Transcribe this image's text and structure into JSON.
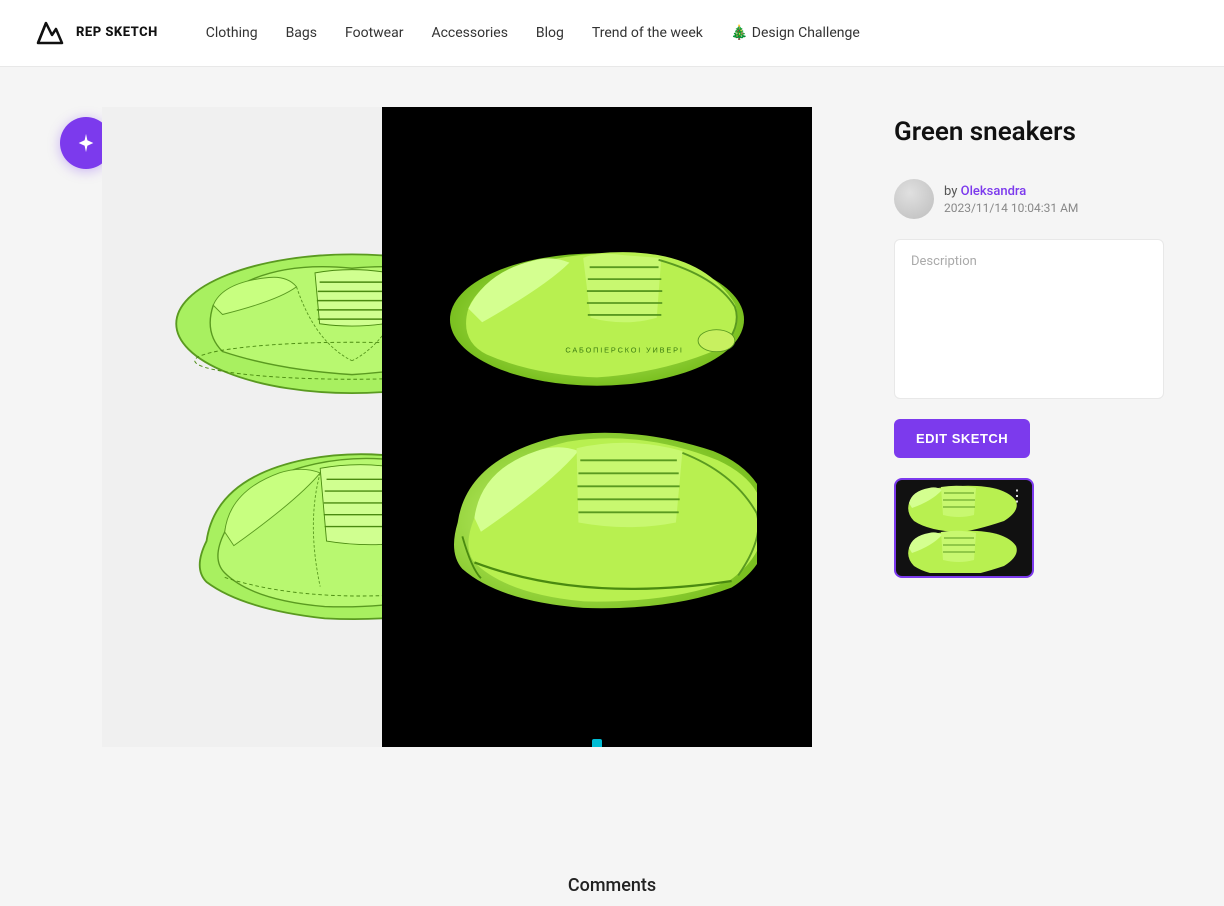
{
  "logo": {
    "name": "REP SKETCH",
    "line1": "REP",
    "line2": "SKETCH"
  },
  "nav": {
    "links": [
      {
        "id": "clothing",
        "label": "Clothing"
      },
      {
        "id": "bags",
        "label": "Bags"
      },
      {
        "id": "footwear",
        "label": "Footwear"
      },
      {
        "id": "accessories",
        "label": "Accessories"
      },
      {
        "id": "blog",
        "label": "Blog"
      },
      {
        "id": "trend",
        "label": "Trend of the week"
      },
      {
        "id": "design",
        "label": "🎄 Design Challenge"
      }
    ]
  },
  "product": {
    "title": "Green sneakers",
    "author_prefix": "by",
    "author_name": "Oleksandra",
    "date": "2023/11/14 10:04:31 AM",
    "description_placeholder": "Description"
  },
  "buttons": {
    "edit_sketch": "EDIT SKETCH"
  },
  "comments": {
    "label": "Comments"
  },
  "sparkle_icon": "✦"
}
